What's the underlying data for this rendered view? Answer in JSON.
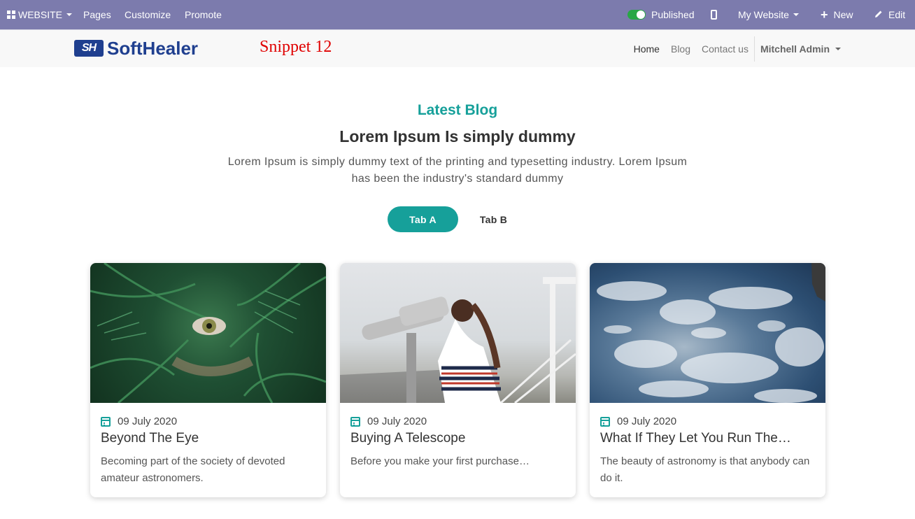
{
  "adminbar": {
    "website_menu": "WEBSITE",
    "pages": "Pages",
    "customize": "Customize",
    "promote": "Promote",
    "published": "Published",
    "my_website": "My Website",
    "new": "New",
    "edit": "Edit"
  },
  "header": {
    "logo_mark": "SH",
    "logo_text": "SoftHealer",
    "snippet_label": "Snippet 12",
    "nav": [
      "Home",
      "Blog",
      "Contact us"
    ],
    "user": "Mitchell Admin"
  },
  "section": {
    "kicker": "Latest Blog",
    "headline": "Lorem Ipsum Is simply dummy",
    "description": "Lorem Ipsum is simply dummy text of the printing and typesetting industry. Lorem Ipsum has been the industry's standard dummy",
    "tabs": [
      "Tab A",
      "Tab B"
    ],
    "active_tab": "Tab A"
  },
  "posts": [
    {
      "date": "09 July 2020",
      "title": "Beyond The Eye",
      "excerpt": "Becoming part of the society of devoted amateur astronomers."
    },
    {
      "date": "09 July 2020",
      "title": "Buying A Telescope",
      "excerpt": "Before you make your first purchase…"
    },
    {
      "date": "09 July 2020",
      "title": "What If They Let You Run The…",
      "excerpt": "The beauty of astronomy is that anybody can do it."
    }
  ],
  "colors": {
    "adminbar": "#7c7bad",
    "accent": "#16a09a",
    "snippet_label": "#e00000",
    "logo": "#1f3f8f"
  }
}
